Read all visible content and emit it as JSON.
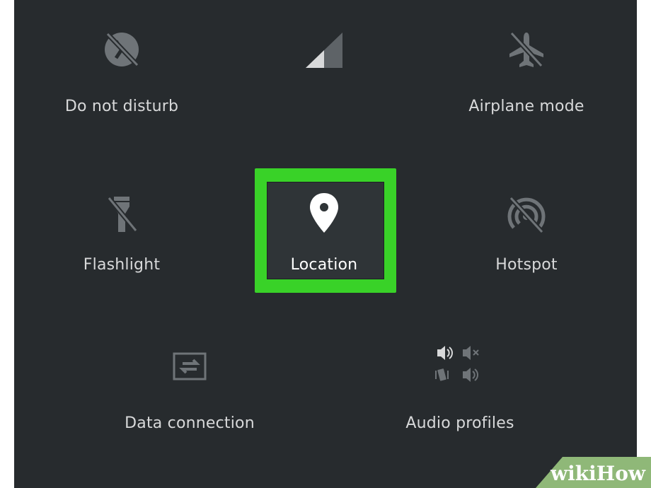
{
  "tiles": {
    "do_not_disturb": {
      "label": "Do not disturb",
      "icon": "do-not-disturb-off-icon",
      "state": "off"
    },
    "signal": {
      "label": "",
      "icon": "cell-signal-icon"
    },
    "airplane": {
      "label": "Airplane mode",
      "icon": "airplane-off-icon",
      "state": "off"
    },
    "flashlight": {
      "label": "Flashlight",
      "icon": "flashlight-off-icon",
      "state": "off"
    },
    "location": {
      "label": "Location",
      "icon": "location-pin-icon",
      "state": "on",
      "highlighted": true
    },
    "hotspot": {
      "label": "Hotspot",
      "icon": "hotspot-off-icon",
      "state": "off"
    },
    "data_connection": {
      "label": "Data connection",
      "icon": "data-transfer-icon"
    },
    "audio_profiles": {
      "label": "Audio profiles",
      "icon": "audio-profiles-icon"
    }
  },
  "watermark": {
    "text": "wikiHow"
  },
  "colors": {
    "panel_background": "#272b2e",
    "icon_inactive": "#6f7478",
    "icon_active": "#ffffff",
    "label_text": "#d8d9da",
    "highlight_frame": "#39d228",
    "watermark_bg": "#8fb878"
  }
}
